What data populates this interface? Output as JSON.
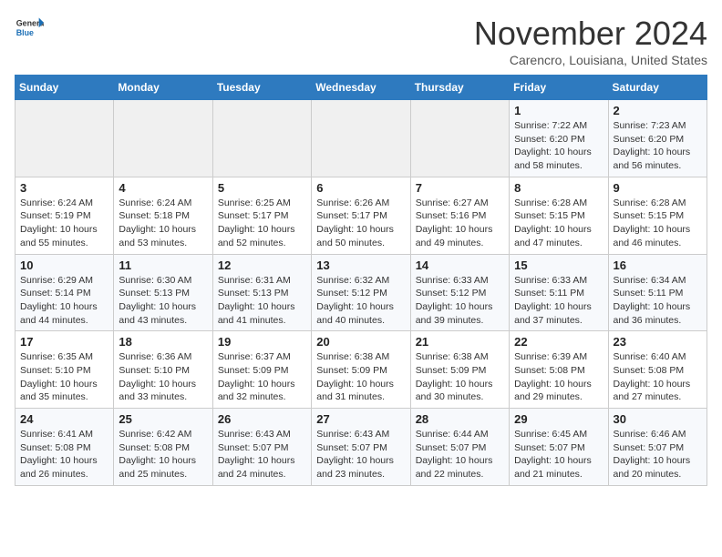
{
  "header": {
    "logo": {
      "general": "General",
      "blue": "Blue"
    },
    "month": "November 2024",
    "location": "Carencro, Louisiana, United States"
  },
  "weekdays": [
    "Sunday",
    "Monday",
    "Tuesday",
    "Wednesday",
    "Thursday",
    "Friday",
    "Saturday"
  ],
  "weeks": [
    [
      {
        "day": "",
        "info": ""
      },
      {
        "day": "",
        "info": ""
      },
      {
        "day": "",
        "info": ""
      },
      {
        "day": "",
        "info": ""
      },
      {
        "day": "",
        "info": ""
      },
      {
        "day": "1",
        "info": "Sunrise: 7:22 AM\nSunset: 6:20 PM\nDaylight: 10 hours and 58 minutes."
      },
      {
        "day": "2",
        "info": "Sunrise: 7:23 AM\nSunset: 6:20 PM\nDaylight: 10 hours and 56 minutes."
      }
    ],
    [
      {
        "day": "3",
        "info": "Sunrise: 6:24 AM\nSunset: 5:19 PM\nDaylight: 10 hours and 55 minutes."
      },
      {
        "day": "4",
        "info": "Sunrise: 6:24 AM\nSunset: 5:18 PM\nDaylight: 10 hours and 53 minutes."
      },
      {
        "day": "5",
        "info": "Sunrise: 6:25 AM\nSunset: 5:17 PM\nDaylight: 10 hours and 52 minutes."
      },
      {
        "day": "6",
        "info": "Sunrise: 6:26 AM\nSunset: 5:17 PM\nDaylight: 10 hours and 50 minutes."
      },
      {
        "day": "7",
        "info": "Sunrise: 6:27 AM\nSunset: 5:16 PM\nDaylight: 10 hours and 49 minutes."
      },
      {
        "day": "8",
        "info": "Sunrise: 6:28 AM\nSunset: 5:15 PM\nDaylight: 10 hours and 47 minutes."
      },
      {
        "day": "9",
        "info": "Sunrise: 6:28 AM\nSunset: 5:15 PM\nDaylight: 10 hours and 46 minutes."
      }
    ],
    [
      {
        "day": "10",
        "info": "Sunrise: 6:29 AM\nSunset: 5:14 PM\nDaylight: 10 hours and 44 minutes."
      },
      {
        "day": "11",
        "info": "Sunrise: 6:30 AM\nSunset: 5:13 PM\nDaylight: 10 hours and 43 minutes."
      },
      {
        "day": "12",
        "info": "Sunrise: 6:31 AM\nSunset: 5:13 PM\nDaylight: 10 hours and 41 minutes."
      },
      {
        "day": "13",
        "info": "Sunrise: 6:32 AM\nSunset: 5:12 PM\nDaylight: 10 hours and 40 minutes."
      },
      {
        "day": "14",
        "info": "Sunrise: 6:33 AM\nSunset: 5:12 PM\nDaylight: 10 hours and 39 minutes."
      },
      {
        "day": "15",
        "info": "Sunrise: 6:33 AM\nSunset: 5:11 PM\nDaylight: 10 hours and 37 minutes."
      },
      {
        "day": "16",
        "info": "Sunrise: 6:34 AM\nSunset: 5:11 PM\nDaylight: 10 hours and 36 minutes."
      }
    ],
    [
      {
        "day": "17",
        "info": "Sunrise: 6:35 AM\nSunset: 5:10 PM\nDaylight: 10 hours and 35 minutes."
      },
      {
        "day": "18",
        "info": "Sunrise: 6:36 AM\nSunset: 5:10 PM\nDaylight: 10 hours and 33 minutes."
      },
      {
        "day": "19",
        "info": "Sunrise: 6:37 AM\nSunset: 5:09 PM\nDaylight: 10 hours and 32 minutes."
      },
      {
        "day": "20",
        "info": "Sunrise: 6:38 AM\nSunset: 5:09 PM\nDaylight: 10 hours and 31 minutes."
      },
      {
        "day": "21",
        "info": "Sunrise: 6:38 AM\nSunset: 5:09 PM\nDaylight: 10 hours and 30 minutes."
      },
      {
        "day": "22",
        "info": "Sunrise: 6:39 AM\nSunset: 5:08 PM\nDaylight: 10 hours and 29 minutes."
      },
      {
        "day": "23",
        "info": "Sunrise: 6:40 AM\nSunset: 5:08 PM\nDaylight: 10 hours and 27 minutes."
      }
    ],
    [
      {
        "day": "24",
        "info": "Sunrise: 6:41 AM\nSunset: 5:08 PM\nDaylight: 10 hours and 26 minutes."
      },
      {
        "day": "25",
        "info": "Sunrise: 6:42 AM\nSunset: 5:08 PM\nDaylight: 10 hours and 25 minutes."
      },
      {
        "day": "26",
        "info": "Sunrise: 6:43 AM\nSunset: 5:07 PM\nDaylight: 10 hours and 24 minutes."
      },
      {
        "day": "27",
        "info": "Sunrise: 6:43 AM\nSunset: 5:07 PM\nDaylight: 10 hours and 23 minutes."
      },
      {
        "day": "28",
        "info": "Sunrise: 6:44 AM\nSunset: 5:07 PM\nDaylight: 10 hours and 22 minutes."
      },
      {
        "day": "29",
        "info": "Sunrise: 6:45 AM\nSunset: 5:07 PM\nDaylight: 10 hours and 21 minutes."
      },
      {
        "day": "30",
        "info": "Sunrise: 6:46 AM\nSunset: 5:07 PM\nDaylight: 10 hours and 20 minutes."
      }
    ]
  ]
}
